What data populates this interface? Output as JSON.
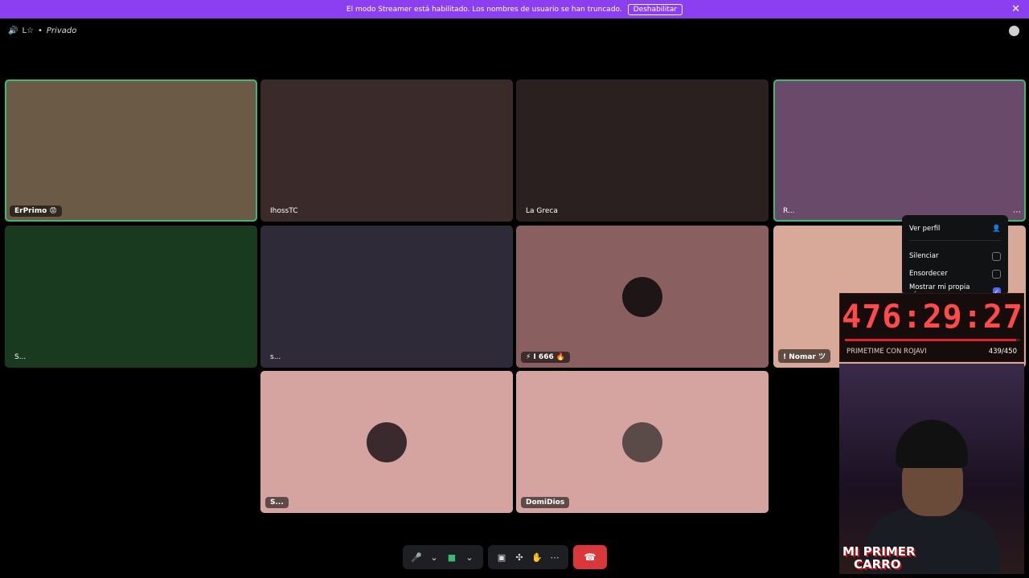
{
  "banner": {
    "text": "El modo Streamer está habilitado. Los nombres de usuario se han truncado.",
    "button": "Deshabilitar",
    "close": "✕"
  },
  "topbar": {
    "server": "L☆",
    "sep": "•",
    "channel": "Privado"
  },
  "tiles": [
    {
      "name": "ErPrimo 😡",
      "bg": "#6b5a45"
    },
    {
      "name": "IhossTC",
      "bg": "#3a2a2a"
    },
    {
      "name": "La Greca",
      "bg": "#2a2020"
    },
    {
      "name": "R...",
      "bg": "#6a4a6a"
    },
    {
      "name": "S...",
      "bg": "#1a3a20"
    },
    {
      "name": "s...",
      "bg": "#2e2a38"
    },
    {
      "name": "⚡ I 666 🔥",
      "bg": "#8a5f60"
    },
    {
      "name": "! Nomar ツ",
      "bg": "#d8a898"
    },
    {
      "name": "S...",
      "bg": "#d6a4a0"
    },
    {
      "name": "DomiDios",
      "bg": "#d6a4a0"
    }
  ],
  "menu": {
    "ver_perfil": "Ver perfil",
    "silenciar": "Silenciar",
    "ensordecer": "Ensordecer",
    "mostrar_camara": "Mostrar mi propia cámara"
  },
  "timer": {
    "clock": "476:29:27",
    "label": "PRIMETIME CON ROJAVI",
    "count": "439/450",
    "progress": 0.976
  },
  "overlay": {
    "line1": "MI PRIMER",
    "line2": "CARRO"
  },
  "controls": {
    "mic": "🎤",
    "mic_caret": "⌄",
    "cam": "■",
    "cam_caret": "⌄",
    "screen": "▣",
    "activities": "✣",
    "soundboard": "✋",
    "more": "⋯",
    "hangup": "☎"
  }
}
